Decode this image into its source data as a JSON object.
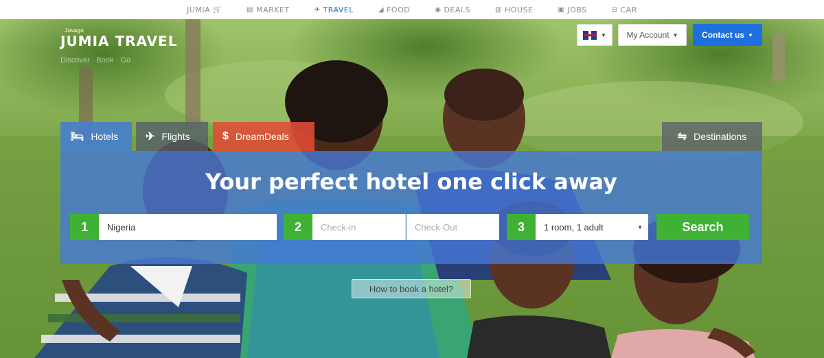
{
  "network": [
    {
      "label": "JUMIA",
      "icon": "cart-icon",
      "glyph": "🛒",
      "active": false
    },
    {
      "label": "MARKET",
      "icon": "market-icon",
      "glyph": "▤",
      "active": false
    },
    {
      "label": "TRAVEL",
      "icon": "plane-icon",
      "glyph": "✈",
      "active": true
    },
    {
      "label": "FOOD",
      "icon": "food-icon",
      "glyph": "◢",
      "active": false
    },
    {
      "label": "DEALS",
      "icon": "tag-icon",
      "glyph": "◉",
      "active": false
    },
    {
      "label": "HOUSE",
      "icon": "house-icon",
      "glyph": "▥",
      "active": false
    },
    {
      "label": "JOBS",
      "icon": "briefcase-icon",
      "glyph": "▣",
      "active": false
    },
    {
      "label": "CAR",
      "icon": "car-icon",
      "glyph": "⊟",
      "active": false
    }
  ],
  "logo": {
    "small": "Jovago",
    "brand": "JUMIA TRAVEL",
    "tagline": "Discover · Book · Go"
  },
  "header": {
    "language_icon": "uk-flag-icon",
    "account_label": "My Account",
    "contact_label": "Contact us"
  },
  "tabs": {
    "hotels": "Hotels",
    "flights": "Flights",
    "deals": "DreamDeals",
    "destinations": "Destinations"
  },
  "search": {
    "title": "Your perfect hotel one click away",
    "step1": "1",
    "step2": "2",
    "step3": "3",
    "destination_value": "Nigeria",
    "checkin_placeholder": "Check-in",
    "checkout_placeholder": "Check-Out",
    "rooms_value": "1 room, 1 adult",
    "search_label": "Search"
  },
  "howto_label": "How to book a hotel?",
  "colors": {
    "accent_blue": "#1e6fe0",
    "panel_blue": "#4678d7",
    "green": "#3fb236",
    "deals_red": "#e14b37"
  }
}
